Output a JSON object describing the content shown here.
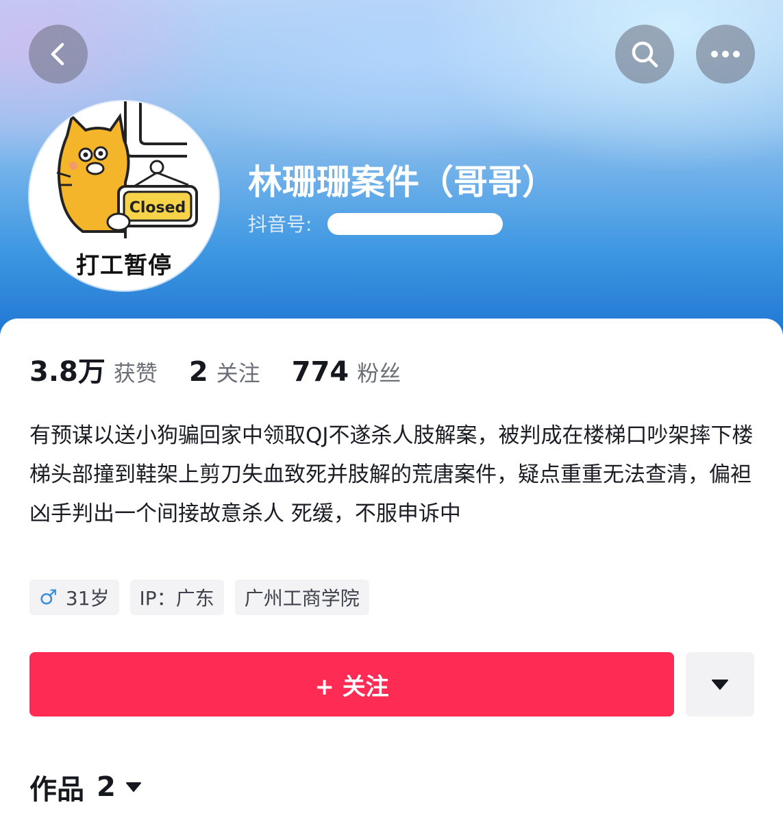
{
  "profile": {
    "name": "林珊珊案件（哥哥）",
    "douyin_id_label": "抖音号:",
    "avatar_caption": "打工暂停",
    "avatar_sign": "Closed"
  },
  "stats": [
    {
      "value": "3.8万",
      "label": "获赞"
    },
    {
      "value": "2",
      "label": "关注"
    },
    {
      "value": "774",
      "label": "粉丝"
    }
  ],
  "bio": "有预谋以送小狗骗回家中领取QJ不遂杀人肢解案，被判成在楼梯口吵架摔下楼梯头部撞到鞋架上剪刀失血致死并肢解的荒唐案件，疑点重重无法查清，偏袒凶手判出一个间接故意杀人 死缓，不服申诉中",
  "tags": {
    "gender_symbol": "♂",
    "age": "31岁",
    "ip": "IP：广东",
    "school": "广州工商学院"
  },
  "actions": {
    "follow_label": "+ 关注"
  },
  "works": {
    "label": "作品",
    "count": "2"
  },
  "icons": {
    "back": "chevron-left-icon",
    "search": "search-icon",
    "more": "more-dots-icon",
    "dropdown": "triangle-down-icon",
    "gender": "male-icon"
  },
  "colors": {
    "accent": "#fe2c55",
    "header_gradient_bottom": "#1a6fcf"
  }
}
